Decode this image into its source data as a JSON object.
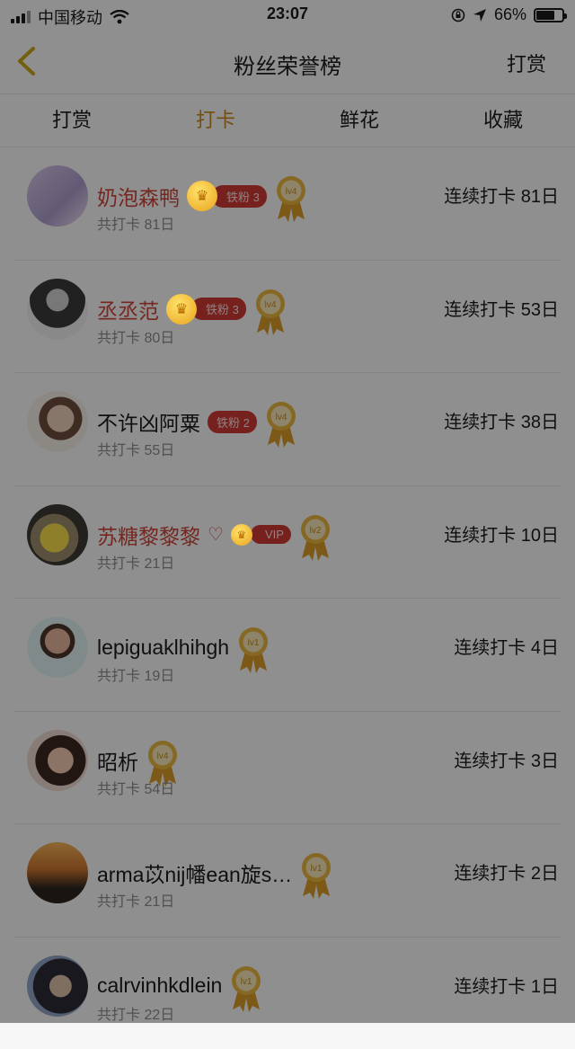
{
  "status_bar": {
    "carrier": "中国移动",
    "time": "23:07",
    "battery": "66%"
  },
  "nav": {
    "title": "粉丝荣誉榜",
    "right": "打赏"
  },
  "tabs": [
    {
      "label": "打赏",
      "active": false
    },
    {
      "label": "打卡",
      "active": true
    },
    {
      "label": "鲜花",
      "active": false
    },
    {
      "label": "收藏",
      "active": false
    }
  ],
  "rows": [
    {
      "name": "奶泡森鸭",
      "name_red": true,
      "badge": "铁粉 3",
      "crown": true,
      "level": "lv4",
      "total": "共打卡 81日",
      "streak": "连续打卡 81日"
    },
    {
      "name": "丞丞范",
      "name_red": true,
      "badge": "铁粉 3",
      "crown": true,
      "level": "lv4",
      "total": "共打卡 80日",
      "streak": "连续打卡 53日"
    },
    {
      "name": "不许凶阿粟",
      "name_red": false,
      "badge": "铁粉 2",
      "crown": false,
      "level": "lv4",
      "total": "共打卡 55日",
      "streak": "连续打卡 38日"
    },
    {
      "name": "苏糖黎黎黎",
      "name_red": true,
      "heart": "♡",
      "badge": "VIP",
      "crown": true,
      "level": "lv2",
      "total": "共打卡 21日",
      "streak": "连续打卡 10日"
    },
    {
      "name": "lepiguaklhihgh",
      "name_red": false,
      "level": "lv1",
      "total": "共打卡 19日",
      "streak": "连续打卡 4日"
    },
    {
      "name": "昭析",
      "name_red": false,
      "level": "lv4",
      "total": "共打卡 54日",
      "streak": "连续打卡 3日"
    },
    {
      "name": "arma苡nij幡ean旋s…",
      "name_red": false,
      "level": "lv1",
      "total": "共打卡 21日",
      "streak": "连续打卡 2日"
    },
    {
      "name": "calrvinhkdlein",
      "name_red": false,
      "level": "lv1",
      "total": "共打卡 22日",
      "streak": "连续打卡 1日"
    }
  ],
  "colors": {
    "accent": "#c9871a",
    "red": "#c9453a",
    "badge": "#cc3a34",
    "overlay": "rgba(0,0,0,0.42)"
  },
  "icons": [
    "signal-icon",
    "wifi-icon",
    "lock-rotation-icon",
    "location-icon",
    "battery-icon",
    "back-chevron-icon",
    "crown-icon",
    "medal-icon"
  ]
}
